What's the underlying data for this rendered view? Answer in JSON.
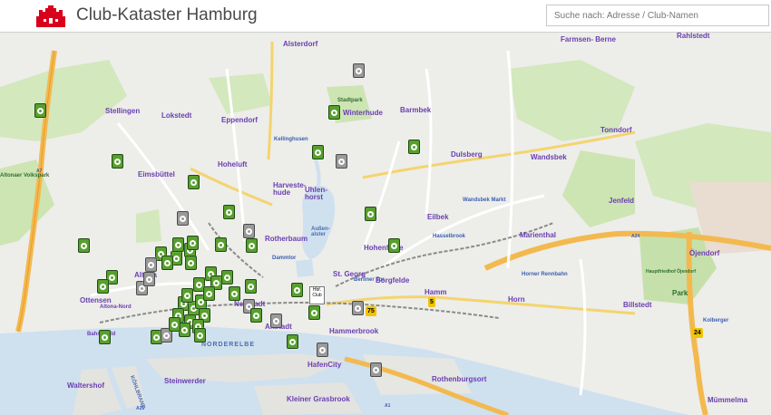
{
  "header": {
    "title": "Club-Kataster Hamburg",
    "search_placeholder": "Suche nach: Adresse / Club-Namen"
  },
  "map": {
    "districts": [
      {
        "name": "Alsterdorf"
      },
      {
        "name": "Farmsen- Berne"
      },
      {
        "name": "Rahlstedt"
      },
      {
        "name": "Stellingen"
      },
      {
        "name": "Lokstedt"
      },
      {
        "name": "Winterhude"
      },
      {
        "name": "Barmbek"
      },
      {
        "name": "Eppendorf"
      },
      {
        "name": "Tonndorf"
      },
      {
        "name": "Hoheluft"
      },
      {
        "name": "Dulsberg"
      },
      {
        "name": "Wandsbek"
      },
      {
        "name": "Eimsbüttel"
      },
      {
        "name": "Harveste- hude"
      },
      {
        "name": "Uhlen- horst"
      },
      {
        "name": "Jenfeld"
      },
      {
        "name": "Eilbek"
      },
      {
        "name": "Marienthal"
      },
      {
        "name": "Rotherbaum"
      },
      {
        "name": "Hohenfelde"
      },
      {
        "name": "Altona"
      },
      {
        "name": "St. Georg"
      },
      {
        "name": "Borgfelde"
      },
      {
        "name": "Ottensen"
      },
      {
        "name": "Hamm"
      },
      {
        "name": "Horn"
      },
      {
        "name": "Billstedt"
      },
      {
        "name": "Neustadt"
      },
      {
        "name": "Altstadt"
      },
      {
        "name": "Hammerbrook"
      },
      {
        "name": "HafenCity"
      },
      {
        "name": "Rothenburgsort"
      },
      {
        "name": "Waltershof"
      },
      {
        "name": "Steinwerder"
      },
      {
        "name": "Kleiner Grasbrook"
      },
      {
        "name": "Altona-Nord"
      },
      {
        "name": "Bahrenfeld"
      },
      {
        "name": "Öjendorf"
      },
      {
        "name": "Park"
      },
      {
        "name": "Kolberger"
      },
      {
        "name": "Mümmelma"
      }
    ],
    "small_labels": [
      {
        "name": "Stadtpark"
      },
      {
        "name": "Altonaer Volkspark"
      },
      {
        "name": "Außen- alster"
      },
      {
        "name": "NORDERELBE"
      },
      {
        "name": "Wandsbek Markt"
      },
      {
        "name": "Hasselbrook"
      },
      {
        "name": "Horner Rennbahn"
      },
      {
        "name": "Kellinghusen"
      },
      {
        "name": "Dammtor"
      },
      {
        "name": "Berliner Tor"
      },
      {
        "name": "A7"
      },
      {
        "name": "A24"
      },
      {
        "name": "A1"
      },
      {
        "name": "A25"
      },
      {
        "name": "Hauptfriedhof Öjendorf"
      },
      {
        "name": "KÖHLBRAND"
      }
    ],
    "highway_numbers": [
      "75",
      "5",
      "24"
    ],
    "badge_text": "Hbf. Club",
    "colors": {
      "water": "#cfe0ee",
      "forest": "#cde5b3",
      "residential": "#efefec",
      "highway": "#f3b94f",
      "marker_open": "#58a02e",
      "marker_closed": "#9a9a9a",
      "district_label": "#6a3fb0"
    },
    "marker_count": 58
  }
}
